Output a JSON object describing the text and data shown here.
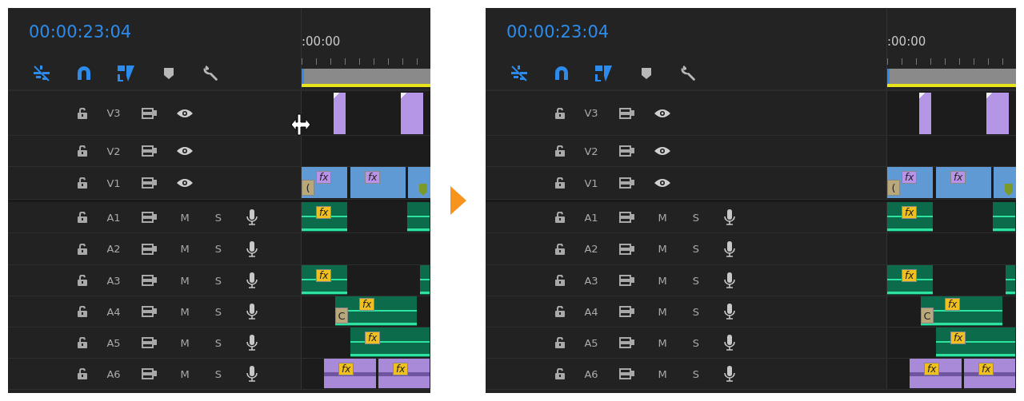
{
  "panels": [
    {
      "timecode": "00:00:23:04",
      "ruler_label": ":00:00",
      "resize_cursor": true,
      "tools": [
        {
          "kind": "nest",
          "on": true
        },
        {
          "kind": "snap",
          "on": true
        },
        {
          "kind": "link",
          "on": true
        },
        {
          "kind": "marker",
          "on": false
        },
        {
          "kind": "settings",
          "on": false
        }
      ],
      "tracks": [
        {
          "name": "V3",
          "kind": "video",
          "clips": [
            {
              "kind": "graphic"
            },
            {
              "kind": "graphic"
            }
          ]
        },
        {
          "name": "V2",
          "kind": "video"
        },
        {
          "name": "V1",
          "kind": "video",
          "clips": [
            {
              "kind": "video",
              "badge": "fx",
              "thumb": "("
            },
            {
              "kind": "video",
              "badge": "fx"
            },
            {
              "kind": "video",
              "marker": true
            }
          ]
        },
        {
          "name": "A1",
          "kind": "audio",
          "mute": "M",
          "solo": "S",
          "clips": [
            {
              "kind": "audio",
              "badge": "fx"
            },
            {
              "kind": "audio"
            }
          ]
        },
        {
          "name": "A2",
          "kind": "audio",
          "mute": "M",
          "solo": "S"
        },
        {
          "name": "A3",
          "kind": "audio",
          "mute": "M",
          "solo": "S",
          "clips": [
            {
              "kind": "audio",
              "badge": "fx"
            },
            {
              "kind": "audio"
            }
          ]
        },
        {
          "name": "A4",
          "kind": "audio",
          "mute": "M",
          "solo": "S",
          "clips": [
            {
              "kind": "audio",
              "badge": "fx",
              "thumb": "C"
            }
          ]
        },
        {
          "name": "A5",
          "kind": "audio",
          "mute": "M",
          "solo": "S",
          "clips": [
            {
              "kind": "audio",
              "badge": "fx"
            }
          ]
        },
        {
          "name": "A6",
          "kind": "audio",
          "mute": "M",
          "solo": "S",
          "clips": [
            {
              "kind": "nested",
              "badge": "fx"
            },
            {
              "kind": "nested",
              "badge": "fx"
            }
          ]
        }
      ]
    },
    {
      "timecode": "00:00:23:04",
      "ruler_label": ":00:00",
      "resize_cursor": false,
      "tools": [
        {
          "kind": "nest",
          "on": true
        },
        {
          "kind": "snap",
          "on": true
        },
        {
          "kind": "link",
          "on": true
        },
        {
          "kind": "marker",
          "on": false
        },
        {
          "kind": "settings",
          "on": false
        }
      ],
      "tracks": [
        {
          "name": "V3",
          "kind": "video",
          "clips": [
            {
              "kind": "graphic"
            },
            {
              "kind": "graphic"
            }
          ]
        },
        {
          "name": "V2",
          "kind": "video"
        },
        {
          "name": "V1",
          "kind": "video",
          "clips": [
            {
              "kind": "video",
              "badge": "fx",
              "thumb": "("
            },
            {
              "kind": "video",
              "badge": "fx"
            },
            {
              "kind": "video",
              "marker": true
            }
          ]
        },
        {
          "name": "A1",
          "kind": "audio",
          "mute": "M",
          "solo": "S",
          "clips": [
            {
              "kind": "audio",
              "badge": "fx"
            },
            {
              "kind": "audio"
            }
          ]
        },
        {
          "name": "A2",
          "kind": "audio",
          "mute": "M",
          "solo": "S"
        },
        {
          "name": "A3",
          "kind": "audio",
          "mute": "M",
          "solo": "S",
          "clips": [
            {
              "kind": "audio",
              "badge": "fx"
            },
            {
              "kind": "audio"
            }
          ]
        },
        {
          "name": "A4",
          "kind": "audio",
          "mute": "M",
          "solo": "S",
          "clips": [
            {
              "kind": "audio",
              "badge": "fx",
              "thumb": "C"
            }
          ]
        },
        {
          "name": "A5",
          "kind": "audio",
          "mute": "M",
          "solo": "S",
          "clips": [
            {
              "kind": "audio",
              "badge": "fx"
            }
          ]
        },
        {
          "name": "A6",
          "kind": "audio",
          "mute": "M",
          "solo": "S",
          "clips": [
            {
              "kind": "nested",
              "badge": "fx"
            },
            {
              "kind": "nested",
              "badge": "fx"
            }
          ]
        }
      ]
    }
  ]
}
